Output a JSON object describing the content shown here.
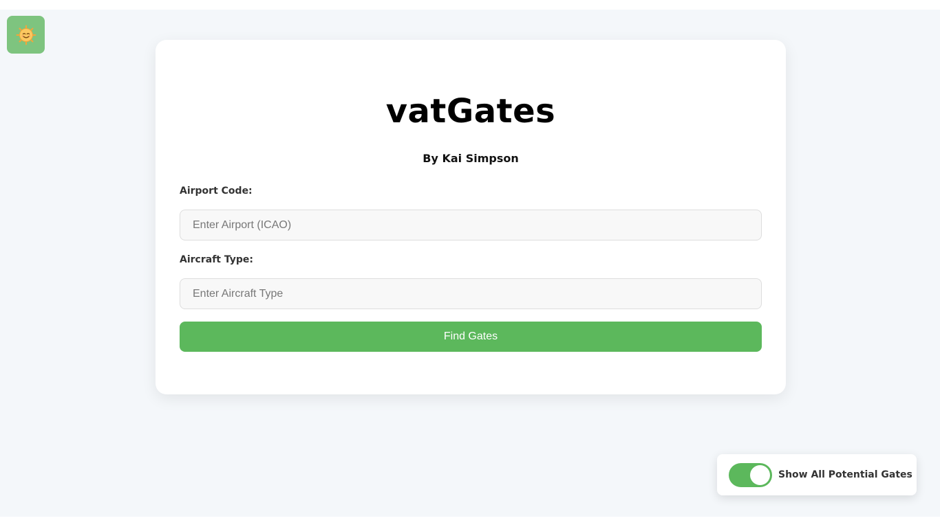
{
  "theme_toggle": {
    "icon": "smiling-sun-icon"
  },
  "card": {
    "title": "vatGates",
    "byline": "By Kai Simpson",
    "airport": {
      "label": "Airport Code:",
      "value": "",
      "placeholder": "Enter Airport (ICAO)"
    },
    "aircraft": {
      "label": "Aircraft Type:",
      "value": "",
      "placeholder": "Enter Aircraft Type"
    },
    "submit_label": "Find Gates"
  },
  "show_all": {
    "label": "Show All Potential Gates",
    "enabled": true
  },
  "colors": {
    "accent_green": "#5cb85c",
    "theme_button": "#7ec47f",
    "page_background": "#f4f7fa"
  }
}
